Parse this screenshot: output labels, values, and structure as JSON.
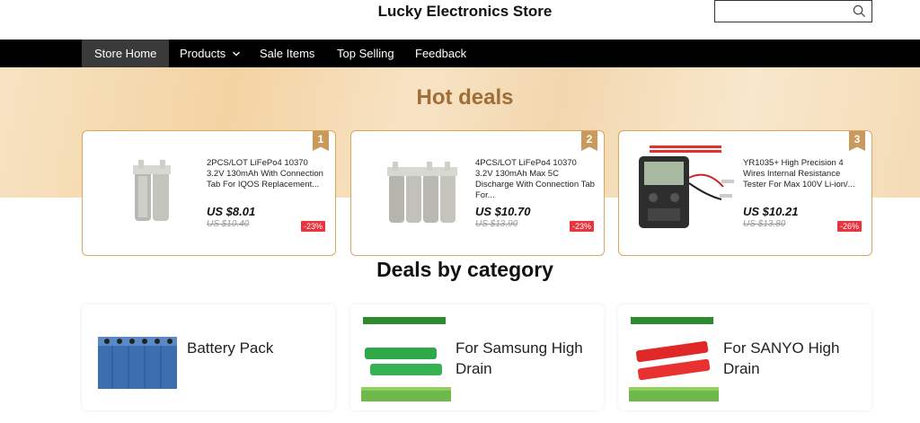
{
  "header": {
    "store_title": "Lucky Electronics Store",
    "search_placeholder": "",
    "search_icon": "search-icon"
  },
  "nav": {
    "items": [
      {
        "label": "Store Home",
        "active": true
      },
      {
        "label": "Products",
        "dropdown": true
      },
      {
        "label": "Sale Items"
      },
      {
        "label": "Top Selling"
      },
      {
        "label": "Feedback"
      }
    ]
  },
  "hero": {
    "title": "Hot deals"
  },
  "deals": [
    {
      "rank": "1",
      "title": "2PCS/LOT LiFePo4 10370 3.2V 130mAh With Connection Tab For IQOS Replacement...",
      "price": "US $8.01",
      "old_price": "US $10.40",
      "discount": "-23%"
    },
    {
      "rank": "2",
      "title": "4PCS/LOT LiFePo4 10370 3.2V 130mAh Max 5C Discharge With Connection Tab For...",
      "price": "US $10.70",
      "old_price": "US $13.90",
      "discount": "-23%"
    },
    {
      "rank": "3",
      "title": "YR1035+ High Precision 4 Wires Internal Resistance Tester For Max 100V Li-ion/...",
      "price": "US $10.21",
      "old_price": "US $13.80",
      "discount": "-26%"
    }
  ],
  "categories": {
    "heading": "Deals by category",
    "items": [
      {
        "label": "Battery Pack"
      },
      {
        "label": "For Samsung High Drain"
      },
      {
        "label": "For SANYO High Drain"
      }
    ]
  },
  "colors": {
    "accent": "#a06d36",
    "nav_bg": "#000000",
    "discount": "#e8343f",
    "card_border": "#d8a85f"
  }
}
